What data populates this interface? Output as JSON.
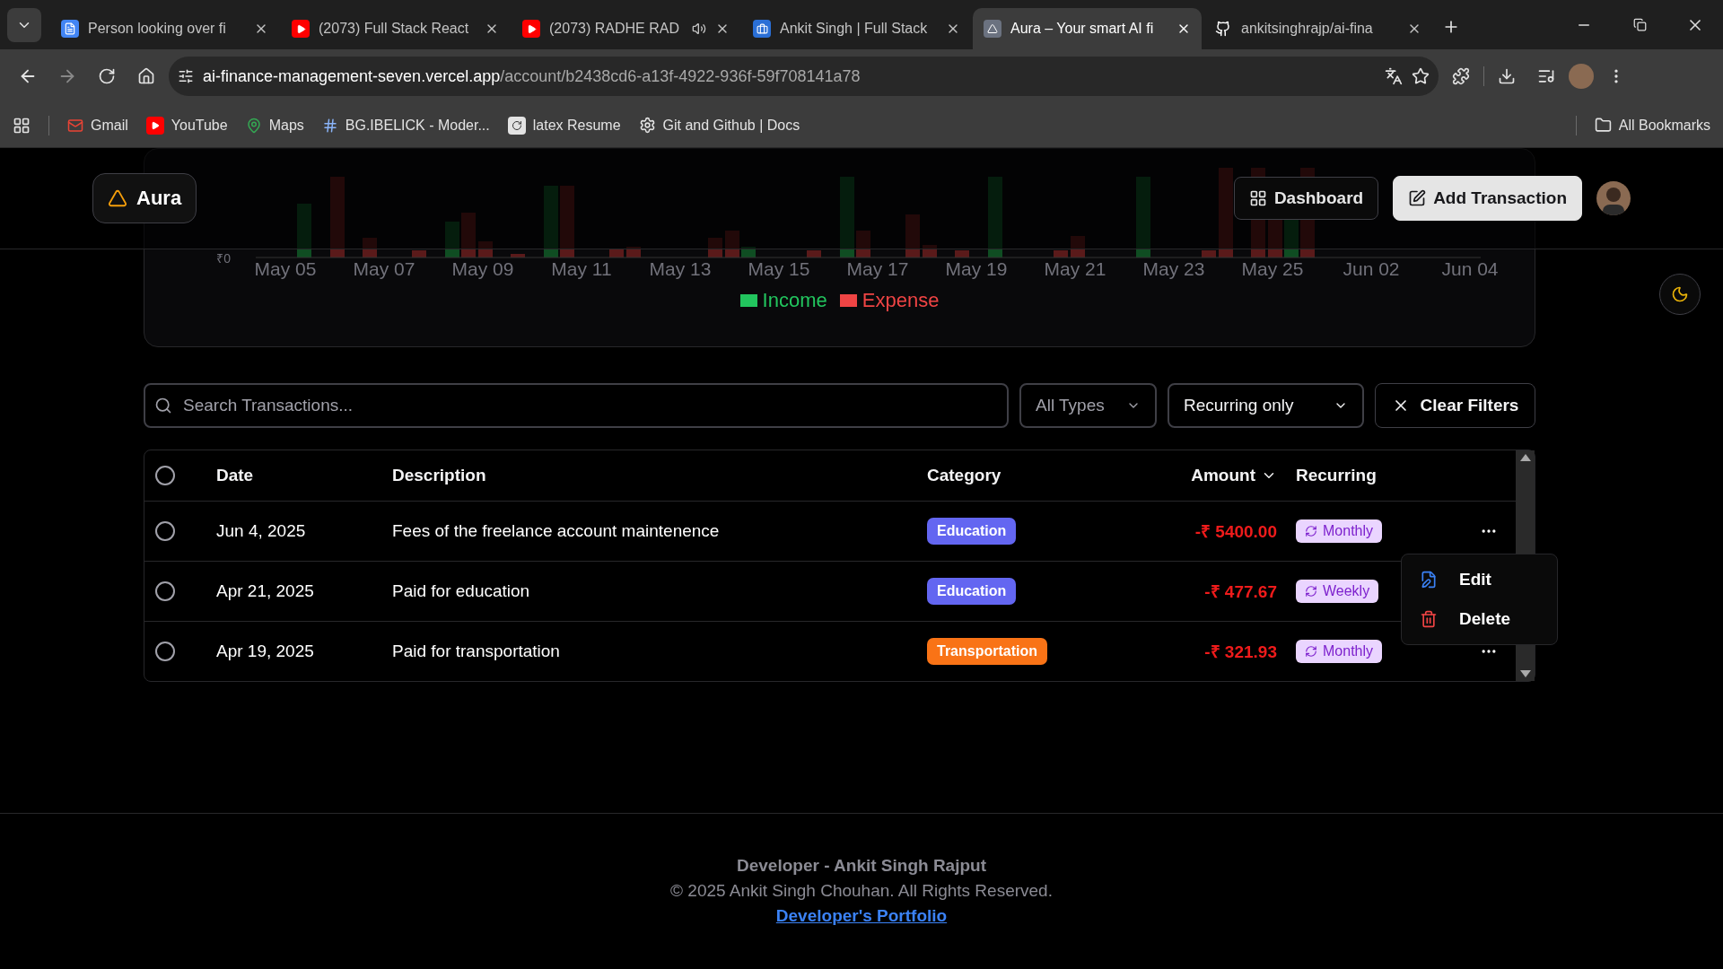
{
  "browser": {
    "tabs": [
      {
        "title": "Person looking over fi",
        "kind": "doc",
        "selected": false,
        "audio": false
      },
      {
        "title": "(2073) Full Stack React",
        "kind": "video",
        "selected": false,
        "audio": false
      },
      {
        "title": "(2073) RADHE RAD",
        "kind": "video",
        "selected": false,
        "audio": true
      },
      {
        "title": "Ankit Singh | Full Stack",
        "kind": "briefcase",
        "selected": false,
        "audio": false
      },
      {
        "title": "Aura – Your smart AI fi",
        "kind": "app",
        "selected": true,
        "audio": false
      },
      {
        "title": "ankitsinghrajp/ai-fina",
        "kind": "github",
        "selected": false,
        "audio": false
      }
    ],
    "url_host": "ai-finance-management-seven.vercel.app",
    "url_path": "/account/b2438cd6-a13f-4922-936f-59f708141a78",
    "bookmarks": [
      {
        "label": "Gmail",
        "kind": "mail"
      },
      {
        "label": "YouTube",
        "kind": "video"
      },
      {
        "label": "Maps",
        "kind": "pin"
      },
      {
        "label": "BG.IBELICK - Moder...",
        "kind": "hash"
      },
      {
        "label": "latex Resume",
        "kind": "six"
      },
      {
        "label": "Git and Github | Docs",
        "kind": "gear"
      }
    ],
    "all_bookmarks": "All Bookmarks"
  },
  "header": {
    "logo": "Aura",
    "buttons": [
      {
        "label": "Dashboard",
        "kind": "outline"
      },
      {
        "label": "Add Transaction",
        "kind": "primary"
      }
    ]
  },
  "chart": {
    "y_tick": "₹0",
    "x_labels": [
      "May 05",
      "May 07",
      "May 09",
      "May 11",
      "May 13",
      "May 15",
      "May 17",
      "May 19",
      "May 21",
      "May 23",
      "May 25",
      "Jun 02",
      "Jun 04"
    ],
    "legend": [
      {
        "label": "Income",
        "color": "#22c55e"
      },
      {
        "label": "Expense",
        "color": "#ef4444"
      }
    ]
  },
  "filters": {
    "search": {
      "placeholder": "Search Transactions..."
    },
    "type_select": "All Types",
    "recurring_select": "Recurring only",
    "clear": "Clear Filters"
  },
  "table": {
    "all_selected": false,
    "columns": [
      {
        "label": "Date",
        "sorted": false
      },
      {
        "label": "Description",
        "sorted": false
      },
      {
        "label": "Category",
        "sorted": false
      },
      {
        "label": "Amount",
        "sorted": true
      },
      {
        "label": "Recurring",
        "sorted": false
      }
    ],
    "rows": [
      {
        "selected": false,
        "date": "Jun 4, 2025",
        "description": "Fees of the freelance account maintenence",
        "category": {
          "label": "Education",
          "color": "#6366f1"
        },
        "amount": "-₹ 5400.00",
        "recurring": "Monthly",
        "menu_open": true
      },
      {
        "selected": false,
        "date": "Apr 21, 2025",
        "description": "Paid for education",
        "category": {
          "label": "Education",
          "color": "#6366f1"
        },
        "amount": "-₹ 477.67",
        "recurring": "Weekly",
        "menu_open": false
      },
      {
        "selected": false,
        "date": "Apr 19, 2025",
        "description": "Paid for transportation",
        "category": {
          "label": "Transportation",
          "color": "#f97316"
        },
        "amount": "-₹ 321.93",
        "recurring": "Monthly",
        "menu_open": false
      }
    ]
  },
  "row_menu": {
    "items": [
      {
        "label": "Edit",
        "kind": "edit"
      },
      {
        "label": "Delete",
        "kind": "delete"
      }
    ]
  },
  "footer": {
    "developer": "Developer - Ankit Singh Rajput",
    "copyright": "© 2025 Ankit Singh Chouhan. All Rights Reserved.",
    "link": "Developer's Portfolio"
  }
}
